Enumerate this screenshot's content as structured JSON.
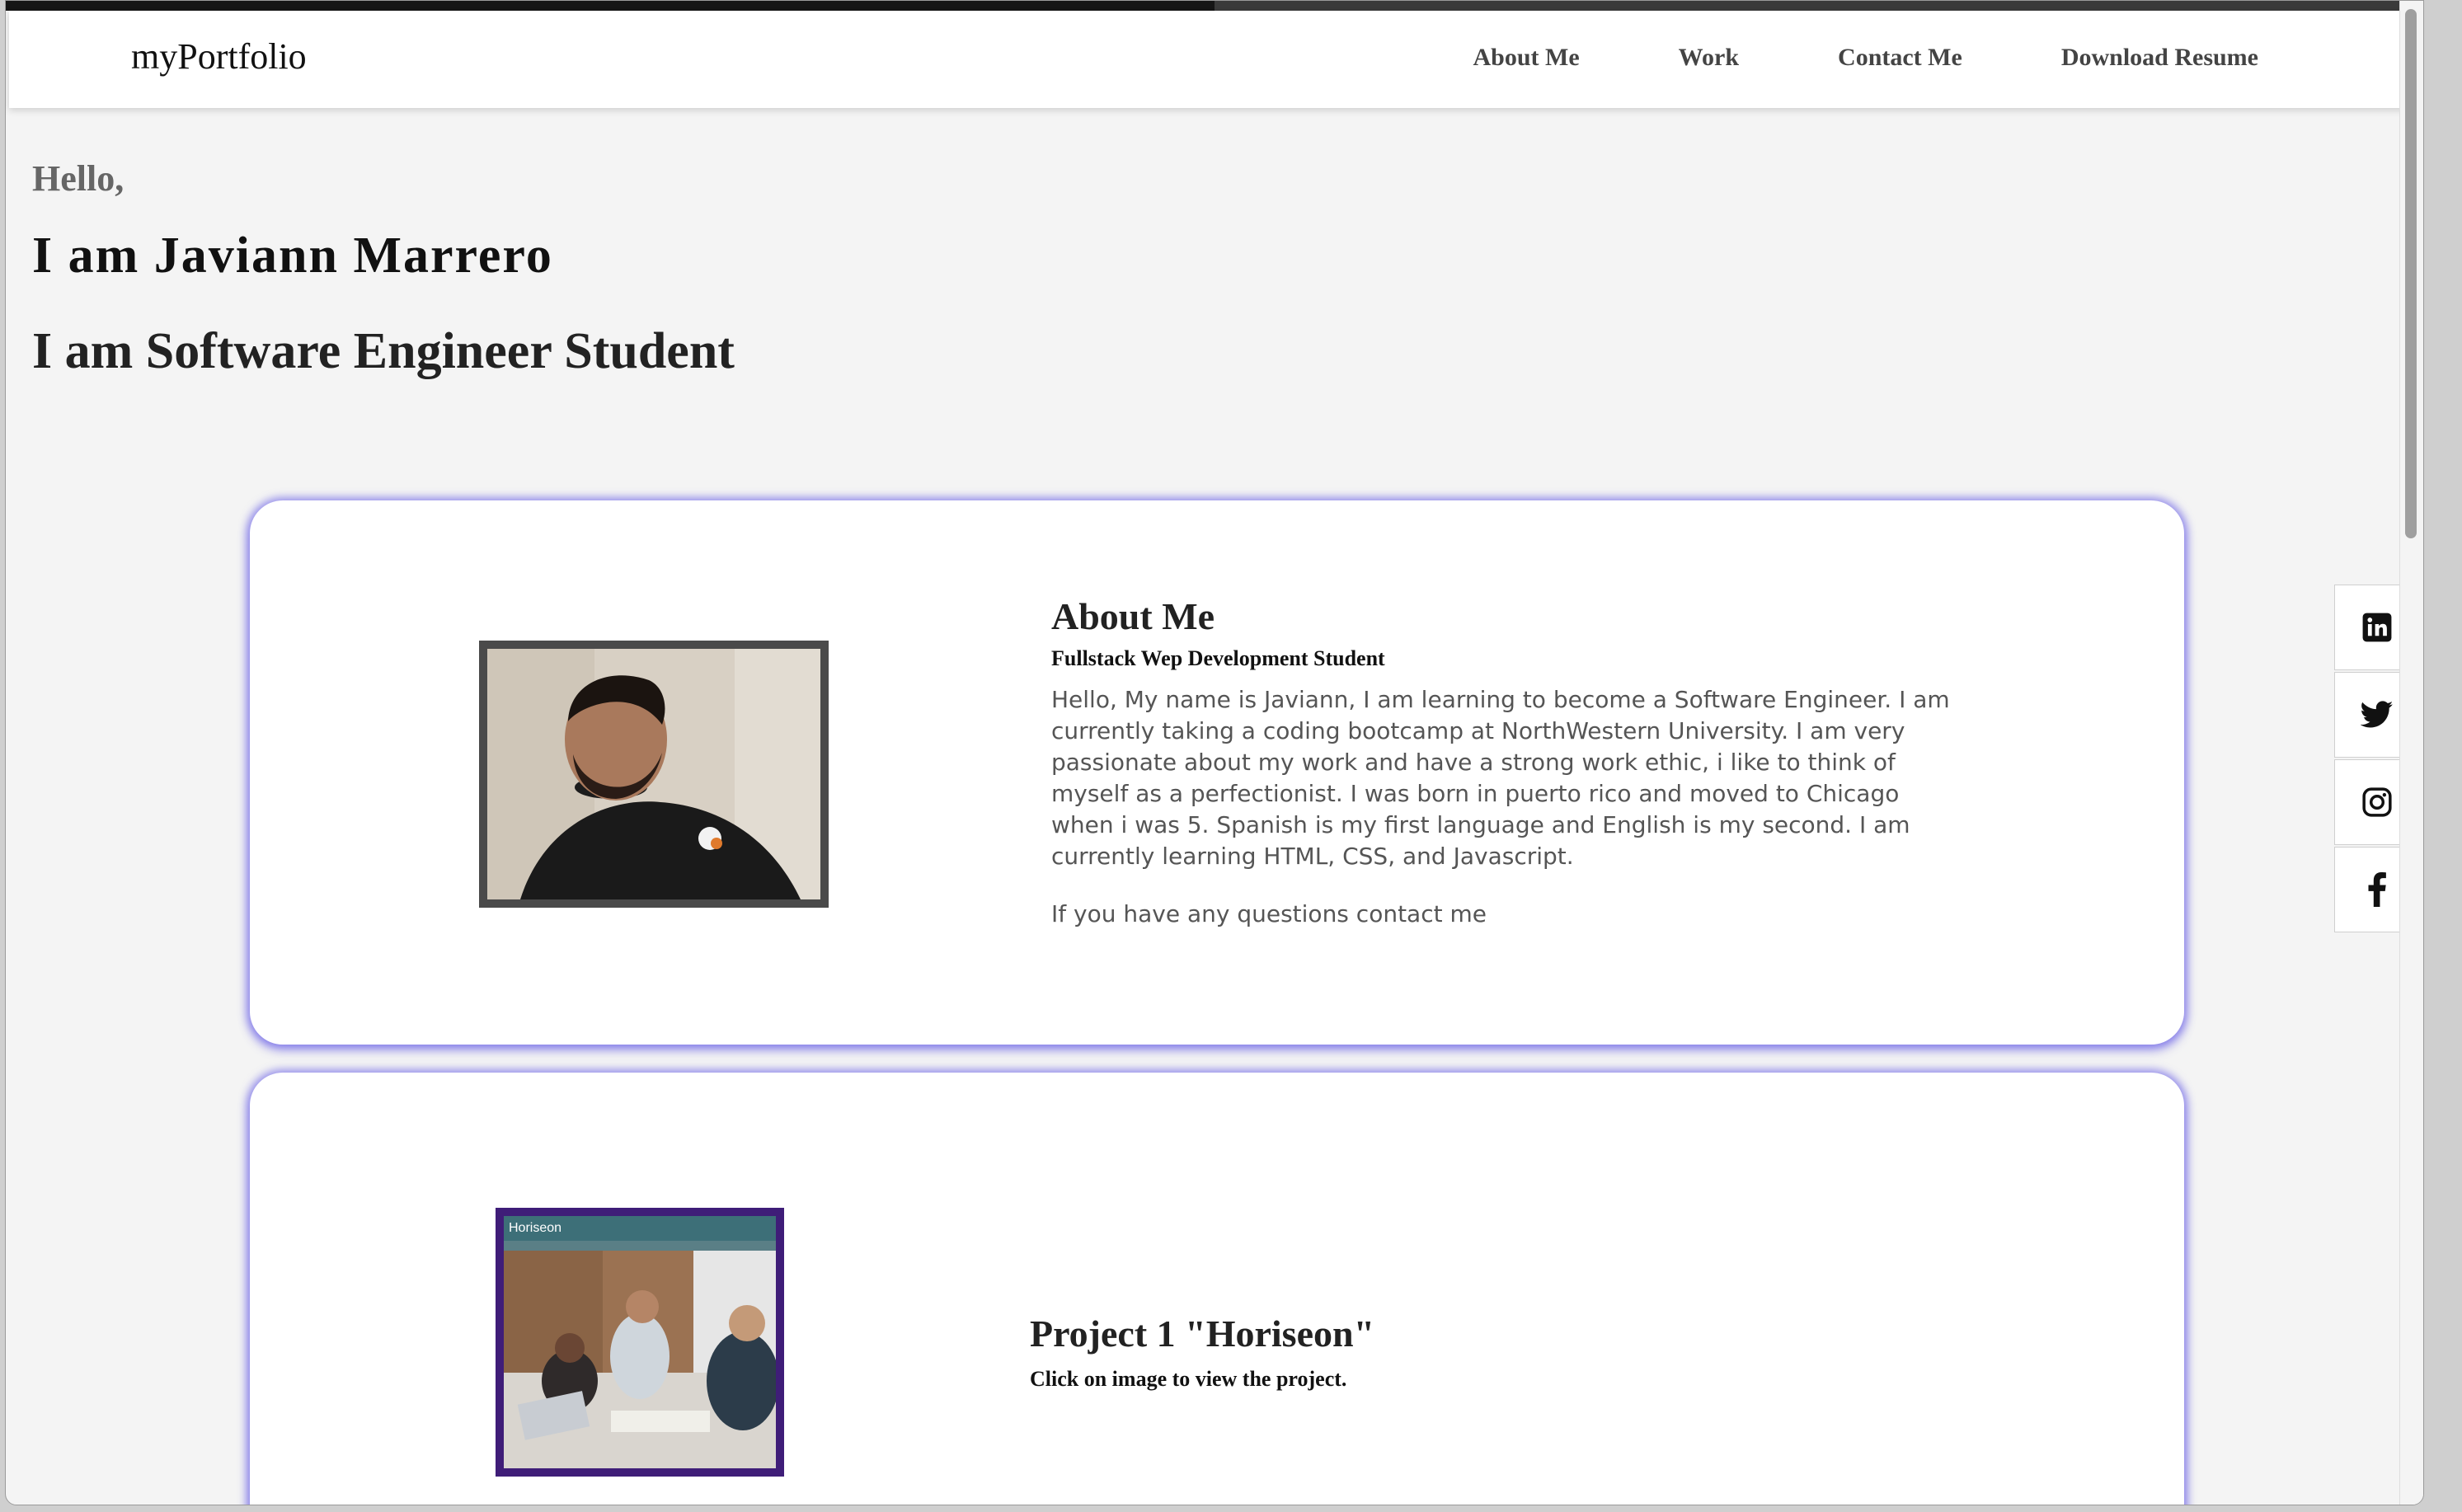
{
  "colors": {
    "background": "#f4f4f4",
    "card_glow": "#5c52e6",
    "text_primary": "#111111",
    "text_muted": "#555555",
    "project_frame": "#3f1d78",
    "photo_frame": "#4a4a4a"
  },
  "page_progress_percent": 50,
  "nav": {
    "brand": "myPortfolio",
    "links": [
      {
        "label": "About Me"
      },
      {
        "label": "Work"
      },
      {
        "label": "Contact Me"
      },
      {
        "label": "Download Resume"
      }
    ]
  },
  "hero": {
    "greeting": "Hello,",
    "name": "I am Javiann Marrero",
    "role": "I am Software Engineer Student"
  },
  "about": {
    "title": "About Me",
    "subtitle": "Fullstack Wep Development Student",
    "body": "Hello, My name is Javiann, I am learning to become a Software Engineer. I am currently taking a coding bootcamp at NorthWestern University. I am very passionate about my work and have a strong work ethic, i like to think of myself as a perfectionist. I was born in puerto rico and moved to Chicago when i was 5. Spanish is my first language and English is my second. I am currently learning HTML, CSS, and Javascript.",
    "contact_note": "If you have any questions contact me"
  },
  "project1": {
    "thumbnail_banner": "Horiseon",
    "title": "Project 1 \"Horiseon\"",
    "subtitle": "Click on image to view the project."
  },
  "social_icons": [
    {
      "name": "linkedin-icon"
    },
    {
      "name": "twitter-icon"
    },
    {
      "name": "instagram-icon"
    },
    {
      "name": "facebook-icon"
    }
  ]
}
